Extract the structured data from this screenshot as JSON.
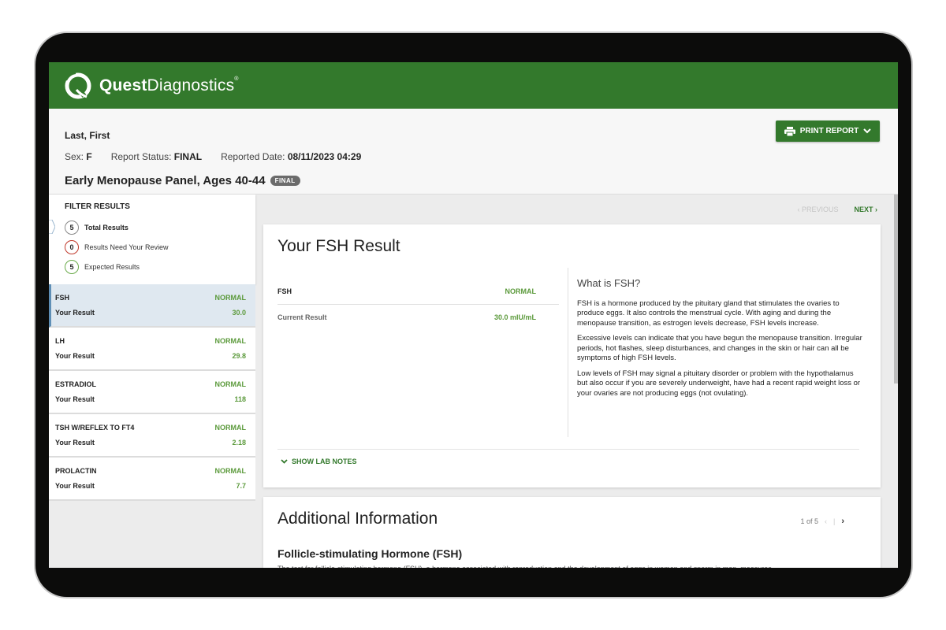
{
  "brand": {
    "name_bold": "Quest",
    "name_light": "Diagnostics",
    "registered": "®",
    "color": "#33792c"
  },
  "patient": {
    "name": "Last, First",
    "sex_label": "Sex:",
    "sex": "F",
    "status_label": "Report Status:",
    "status": "FINAL",
    "date_label": "Reported Date:",
    "date": "08/11/2023 04:29"
  },
  "panel": {
    "title": "Early Menopause Panel, Ages 40-44",
    "badge": "FINAL"
  },
  "toolbar": {
    "print_label": "PRINT REPORT"
  },
  "filter": {
    "title": "FILTER RESULTS",
    "items": [
      {
        "count": "5",
        "label": "Total Results"
      },
      {
        "count": "0",
        "label": "Results Need Your Review"
      },
      {
        "count": "5",
        "label": "Expected Results"
      }
    ]
  },
  "results": [
    {
      "name": "FSH",
      "status": "NORMAL",
      "label": "Your Result",
      "value": "30.0"
    },
    {
      "name": "LH",
      "status": "NORMAL",
      "label": "Your Result",
      "value": "29.8"
    },
    {
      "name": "ESTRADIOL",
      "status": "NORMAL",
      "label": "Your Result",
      "value": "118"
    },
    {
      "name": "TSH W/REFLEX TO FT4",
      "status": "NORMAL",
      "label": "Your Result",
      "value": "2.18"
    },
    {
      "name": "PROLACTIN",
      "status": "NORMAL",
      "label": "Your Result",
      "value": "7.7"
    }
  ],
  "pager": {
    "previous": "PREVIOUS",
    "next": "NEXT"
  },
  "detail": {
    "title": "Your FSH Result",
    "test": "FSH",
    "status": "NORMAL",
    "current_label": "Current Result",
    "current_value": "30.0 mIU/mL",
    "info_title": "What is FSH?",
    "paragraphs": [
      "FSH is a hormone produced by the pituitary gland that stimulates the ovaries to produce eggs. It also controls the menstrual cycle. With aging and during the menopause transition, as estrogen levels decrease, FSH levels increase.",
      "Excessive levels can indicate that you have begun the menopause transition. Irregular periods, hot flashes, sleep disturbances, and changes in the skin or hair can all be symptoms of high FSH levels.",
      "Low levels of FSH may signal a pituitary disorder or problem with the hypothalamus but also occur if you are severely underweight, have had a recent rapid weight loss or your ovaries are not producing eggs (not ovulating)."
    ],
    "lab_notes": "SHOW LAB NOTES"
  },
  "additional": {
    "title": "Additional Information",
    "pagination": "1 of 5",
    "subtitle": "Follicle-stimulating Hormone (FSH)",
    "text": "The test for follicle-stimulating hormone (FSH), a hormone associated with reproduction and the development of eggs in women and sperm in men, measures"
  }
}
